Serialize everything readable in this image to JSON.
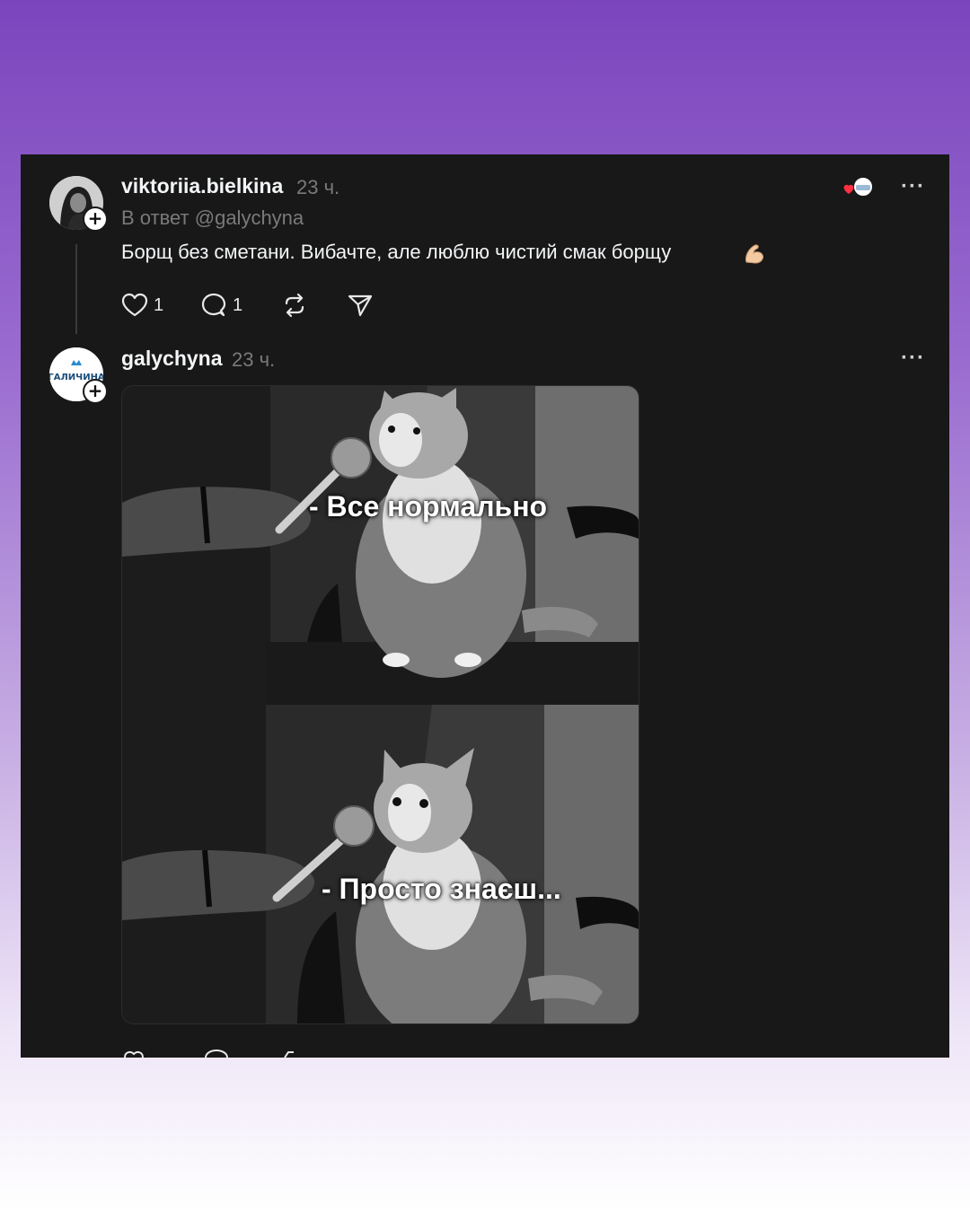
{
  "post1": {
    "username": "viktoriia.bielkina",
    "time": "23 ч.",
    "reply_to": "В ответ @galychyna",
    "text": "Борщ без сметани. Вибачте, але люблю чистий смак борщу",
    "emoji_icon": "flexed-biceps",
    "likes": "1",
    "comments": "1",
    "avatar": "user-photo-avatar",
    "liked_by_icon": "liked-by-author-avatar"
  },
  "post2": {
    "username": "galychyna",
    "time": "23 ч.",
    "avatar_logo_text": "ГАЛИЧИНА",
    "meme": {
      "caption_top": "- Все нормально",
      "caption_bottom": "- Просто знаєш..."
    }
  },
  "colors": {
    "panel_bg": "#181818",
    "text_primary": "#f3f5f7",
    "text_secondary": "#7a7a7a",
    "like_heart": "#ff3040"
  }
}
